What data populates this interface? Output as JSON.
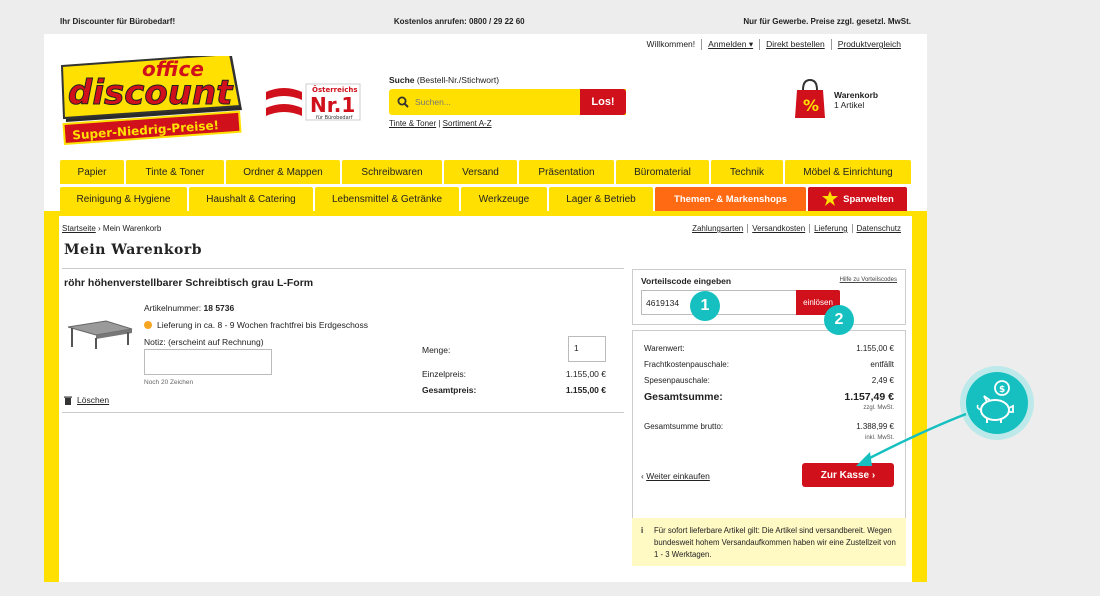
{
  "topbar": {
    "left": "Ihr Discounter für Bürobedarf!",
    "center": "Kostenlos anrufen: 0800 / 29 22 60",
    "right": "Nur für Gewerbe. Preise zzgl. gesetzl. MwSt."
  },
  "util": {
    "welcome": "Willkommen!",
    "login": "Anmelden",
    "quick_order": "Direkt bestellen",
    "compare": "Produktvergleich"
  },
  "logo": {
    "line1": "office",
    "line2": "discount",
    "tagline": "Super-Niedrig-Preise!"
  },
  "nr1": {
    "top": "Österreichs",
    "main": "Nr.1",
    "sub": "für Bürobedarf"
  },
  "search": {
    "label_bold": "Suche",
    "label_rest": " (Bestell-Nr./Stichwort)",
    "placeholder": "Suchen...",
    "button": "Los!",
    "link1": "Tinte & Toner",
    "link2": "Sortiment A-Z"
  },
  "cart": {
    "title": "Warenkorb",
    "count": "1 Artikel"
  },
  "nav": {
    "row1": [
      "Papier",
      "Tinte & Toner",
      "Ordner & Mappen",
      "Schreibwaren",
      "Versand",
      "Präsentation",
      "Büromaterial",
      "Technik",
      "Möbel & Einrichtung"
    ],
    "row2": [
      "Reinigung & Hygiene",
      "Haushalt & Catering",
      "Lebensmittel & Getränke",
      "Werkzeuge",
      "Lager & Betrieb",
      "Themen- & Markenshops",
      "Sparwelten"
    ]
  },
  "breadcrumb": {
    "home": "Startseite",
    "sep": " › ",
    "current": "Mein Warenkorb"
  },
  "infolinks": [
    "Zahlungsarten",
    "Versandkosten",
    "Lieferung",
    "Datenschutz"
  ],
  "page_title": "Mein Warenkorb",
  "product": {
    "title": "röhr höhenverstellbarer Schreibtisch grau L-Form",
    "art_label": "Artikelnummer: ",
    "art_no": "18 5736",
    "delivery": "Lieferung in ca. 8 - 9 Wochen frachtfrei bis Erdgeschoss",
    "note_label": "Notiz: (erscheint auf Rechnung)",
    "note_chars": "Noch 20 Zeichen",
    "delete": "Löschen",
    "qty_label": "Menge:",
    "qty": "1",
    "unit_label": "Einzelpreis:",
    "unit_price": "1.155,00 €",
    "total_label": "Gesamtpreis:",
    "total_price": "1.155,00 €"
  },
  "voucher": {
    "label": "Vorteilscode eingeben",
    "help": "Hilfe zu Vorteilscodes",
    "value": "4619134",
    "button": "einlösen"
  },
  "summary": {
    "warenwert_label": "Warenwert:",
    "warenwert": "1.155,00 €",
    "fracht_label": "Frachtkostenpauschale:",
    "fracht": "entfällt",
    "spesen_label": "Spesenpauschale:",
    "spesen": "2,49 €",
    "gesamt_label": "Gesamtsumme:",
    "gesamt": "1.157,49 €",
    "gesamt_note": "zzgl. MwSt.",
    "brutto_label": "Gesamtsumme brutto:",
    "brutto": "1.388,99 €",
    "brutto_note": "inkl. MwSt.",
    "continue": "Weiter einkaufen",
    "checkout": "Zur Kasse"
  },
  "note": {
    "icon": "i",
    "text": "Für sofort lieferbare Artikel gilt: Die Artikel sind versandbereit. Wegen bundesweit hohem Versandaufkommen haben wir eine Zustellzeit von 1 - 3 Werktagen."
  },
  "badges": {
    "one": "1",
    "two": "2"
  },
  "colors": {
    "yellow": "#ffe000",
    "red": "#d0101a",
    "orange": "#ff6a13",
    "teal": "#17c0c0"
  }
}
